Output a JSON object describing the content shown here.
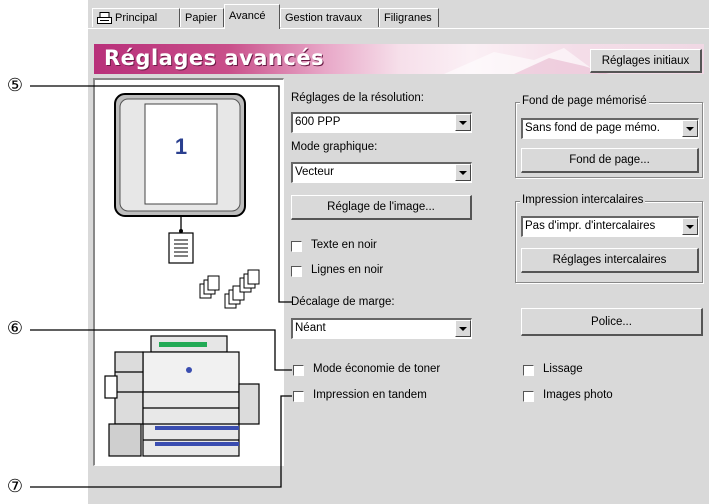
{
  "tabs": [
    {
      "label": "Principal"
    },
    {
      "label": "Papier"
    },
    {
      "label": "Avancé"
    },
    {
      "label": "Gestion travaux"
    },
    {
      "label": "Filigranes"
    }
  ],
  "banner": {
    "title": "Réglages avancés",
    "reset_button": "Réglages initiaux"
  },
  "preview": {
    "page_number": "1"
  },
  "resolution": {
    "label": "Réglages de la résolution:",
    "value": "600 PPP"
  },
  "graphics_mode": {
    "label": "Mode graphique:",
    "value": "Vecteur"
  },
  "image_adjust_button": "Réglage de l'image...",
  "text_black": {
    "label": "Texte en noir",
    "checked": false
  },
  "lines_black": {
    "label": "Lignes en noir",
    "checked": false
  },
  "margin_shift": {
    "label": "Décalage de marge:",
    "value": "Néant"
  },
  "toner_save": {
    "label": "Mode économie de toner",
    "checked": false
  },
  "tandem": {
    "label": "Impression en tandem",
    "checked": false
  },
  "overlay": {
    "group_title": "Fond de page mémorisé",
    "value": "Sans fond de page mémo.",
    "button": "Fond de page..."
  },
  "interleave": {
    "group_title": "Impression intercalaires",
    "value": "Pas d'impr. d'intercalaires",
    "button": "Réglages intercalaires"
  },
  "font_button": "Police...",
  "smoothing": {
    "label": "Lissage",
    "checked": false
  },
  "photo": {
    "label": "Images photo",
    "checked": false
  },
  "callouts": [
    "⑤",
    "⑥",
    "⑦"
  ]
}
